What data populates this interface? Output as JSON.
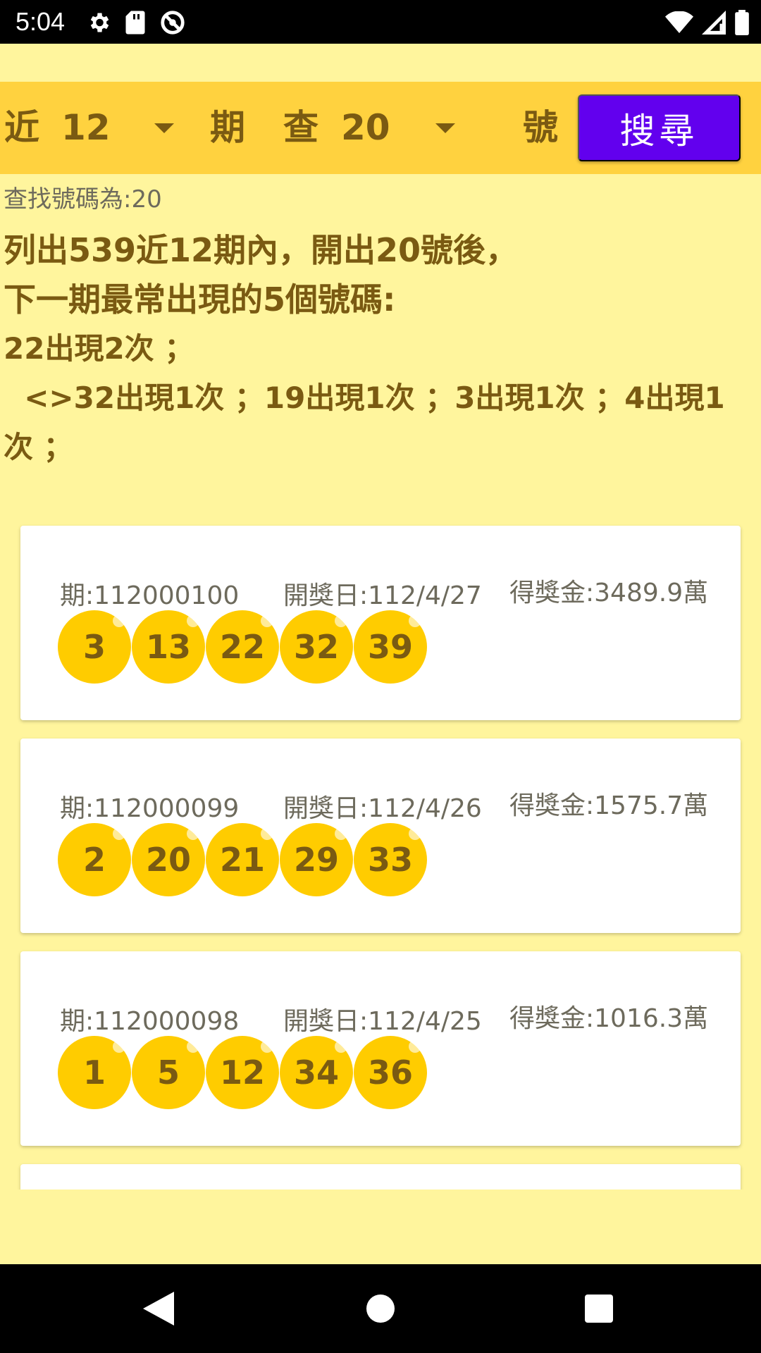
{
  "status_bar": {
    "time": "5:04",
    "left_icons": [
      "gear-icon",
      "sd-card-icon",
      "do-not-disturb-icon"
    ],
    "right_icons": [
      "wifi-icon",
      "cell-signal-icon",
      "battery-icon"
    ]
  },
  "filter_bar": {
    "prefix_label": "近",
    "period_value": "12",
    "period_suffix": "期",
    "query_prefix": "查",
    "number_value": "20",
    "number_suffix": "號",
    "search_label": "搜尋"
  },
  "result": {
    "query_label": "查找號碼為:20",
    "heading_line1": "列出539近12期內，開出20號後，",
    "heading_line2": "下一期最常出現的5個號碼:",
    "line1": "22出現2次 ；",
    "line2": "  <>32出現1次 ；19出現1次 ；3出現1次 ；4出現1",
    "line3": "次 ；"
  },
  "draws": [
    {
      "period": "期:112000100",
      "date": "開獎日:112/4/27",
      "prize": "得獎金:3489.9萬",
      "numbers": [
        "3",
        "13",
        "22",
        "32",
        "39"
      ]
    },
    {
      "period": "期:112000099",
      "date": "開獎日:112/4/26",
      "prize": "得獎金:1575.7萬",
      "numbers": [
        "2",
        "20",
        "21",
        "29",
        "33"
      ]
    },
    {
      "period": "期:112000098",
      "date": "開獎日:112/4/25",
      "prize": "得獎金:1016.3萬",
      "numbers": [
        "1",
        "5",
        "12",
        "34",
        "36"
      ]
    }
  ],
  "nav_bar": {
    "buttons": [
      "back-icon",
      "home-icon",
      "recents-icon"
    ]
  },
  "colors": {
    "background": "#FFF59D",
    "filter_bar": "#FFD23F",
    "search_button": "#6200EE",
    "ball": "#FFCC00",
    "text_brown": "#7A5A12"
  }
}
